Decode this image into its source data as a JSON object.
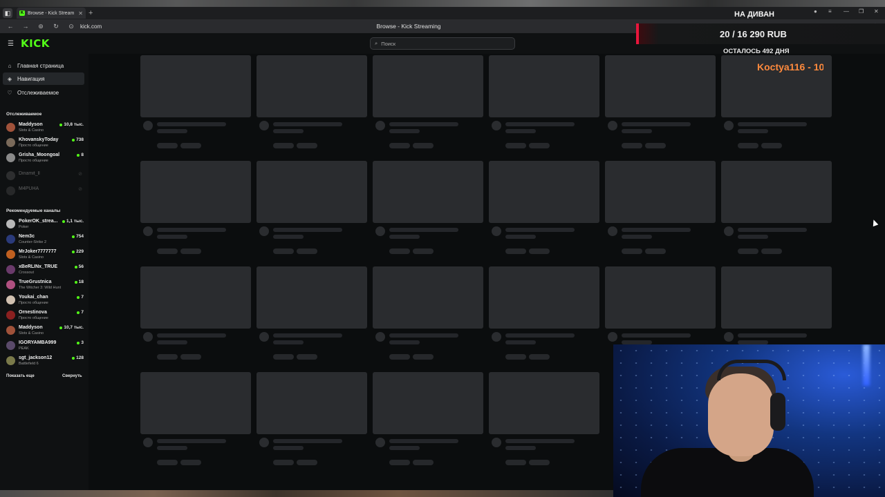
{
  "browser": {
    "tab_title": "Browse - Kick Stream",
    "url": "kick.com",
    "page_title": "Browse - Kick Streaming"
  },
  "header": {
    "logo": "KICK",
    "search_placeholder": "Поиск"
  },
  "nav": [
    {
      "label": "Главная страница",
      "icon": "home-icon"
    },
    {
      "label": "Навигация",
      "icon": "compass-icon",
      "active": true
    },
    {
      "label": "Отслеживаемое",
      "icon": "heart-icon"
    }
  ],
  "followed": {
    "heading": "Отслеживаемое",
    "items": [
      {
        "name": "Maddyson",
        "category": "Slots & Casino",
        "viewers": "10,8 тыс.",
        "color": "#a0523a"
      },
      {
        "name": "KhovanskyToday",
        "category": "Просто общение",
        "viewers": "738",
        "color": "#7a6a5a"
      },
      {
        "name": "Grisha_Moongoal",
        "category": "Просто общение",
        "viewers": "8",
        "color": "#8a8a8a"
      },
      {
        "name": "Dinamit_ll",
        "category": "",
        "viewers": "",
        "color": "#666666"
      },
      {
        "name": "M4PUHA",
        "category": "",
        "viewers": "",
        "color": "#555555"
      }
    ]
  },
  "recommended": {
    "heading": "Рекомендуемые каналы",
    "items": [
      {
        "name": "PokerOK_strea...",
        "category": "Poker",
        "viewers": "1,1 тыс.",
        "color": "#b8b8b8"
      },
      {
        "name": "Nem3c",
        "category": "Counter-Strike 2",
        "viewers": "754",
        "color": "#2a3a7a"
      },
      {
        "name": "MrJoker7777777",
        "category": "Slots & Casino",
        "viewers": "229",
        "color": "#c06020"
      },
      {
        "name": "xBeRLINx_TRUE",
        "category": "Crossout",
        "viewers": "56",
        "color": "#6a3a6a"
      },
      {
        "name": "TrueGrustnica",
        "category": "The Witcher 3: Wild Hunt",
        "viewers": "18",
        "color": "#b05080"
      },
      {
        "name": "Youkai_chan",
        "category": "Просто общение",
        "viewers": "7",
        "color": "#d0c0b0"
      },
      {
        "name": "Ornestinova",
        "category": "Просто общение",
        "viewers": "7",
        "color": "#8a2020"
      },
      {
        "name": "Maddyson",
        "category": "Slots & Casino",
        "viewers": "10,7 тыс.",
        "color": "#a0523a"
      },
      {
        "name": "IGORYAMBA999",
        "category": "PEAK",
        "viewers": "3",
        "color": "#5a4a6a"
      },
      {
        "name": "sgt_jackson12",
        "category": "Battlefield 6",
        "viewers": "128",
        "color": "#7a7a4a"
      }
    ],
    "show_more": "Показать еще",
    "collapse": "Свернуть"
  },
  "overlay": {
    "title": "НА ДИВАН",
    "amount": "20 / 16 290 RUB",
    "remaining": "ОСТАЛОСЬ 492 ДНЯ",
    "donor": "Koctya116 - 10"
  },
  "colors": {
    "accent": "#53fc18",
    "sidebar_bg": "#0f1112",
    "page_bg": "#0b0d0e",
    "skeleton": "#2a2c2f"
  }
}
